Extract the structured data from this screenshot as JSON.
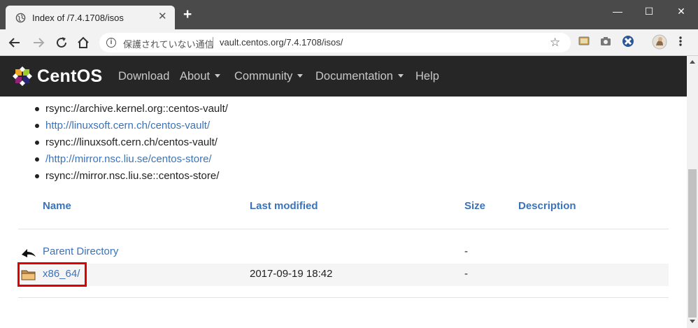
{
  "browser": {
    "tab_title": "Index of /7.4.1708/isos",
    "tab_close": "✕",
    "new_tab": "+",
    "window_controls": {
      "minimize": "—",
      "maximize": "☐",
      "close": "✕"
    },
    "security_label": "保護されていない通信",
    "url": "vault.centos.org/7.4.1708/isos/",
    "icons": [
      "back-icon",
      "forward-icon",
      "reload-icon",
      "home-icon",
      "info-icon",
      "star-icon",
      "cast-icon",
      "camera-icon",
      "extension-icon",
      "profile-avatar",
      "menu-icon"
    ]
  },
  "site": {
    "logo_text": "CentOS",
    "nav": [
      {
        "label": "Download",
        "dropdown": false
      },
      {
        "label": "About",
        "dropdown": true
      },
      {
        "label": "Community",
        "dropdown": true
      },
      {
        "label": "Documentation",
        "dropdown": true
      },
      {
        "label": "Help",
        "dropdown": false
      }
    ]
  },
  "mirrors": [
    {
      "text": "rsync://archive.kernel.org::centos-vault/",
      "link": false
    },
    {
      "text": "http://linuxsoft.cern.ch/centos-vault/",
      "link": true
    },
    {
      "text": "rsync://linuxsoft.cern.ch/centos-vault/",
      "link": false
    },
    {
      "text": "/http://mirror.nsc.liu.se/centos-store/",
      "link": true
    },
    {
      "text": "rsync://mirror.nsc.liu.se::centos-store/",
      "link": false
    }
  ],
  "table": {
    "headers": {
      "name": "Name",
      "modified": "Last modified",
      "size": "Size",
      "description": "Description"
    },
    "rows": [
      {
        "name": "Parent Directory",
        "modified": "",
        "size": "-",
        "icon": "back-arrow-icon"
      },
      {
        "name": "x86_64/",
        "modified": "2017-09-19 18:42",
        "size": "-",
        "icon": "folder-icon",
        "highlighted": true
      }
    ]
  },
  "colors": {
    "link": "#3b73b9",
    "header_bg": "#262626",
    "highlight": "#e00000"
  }
}
